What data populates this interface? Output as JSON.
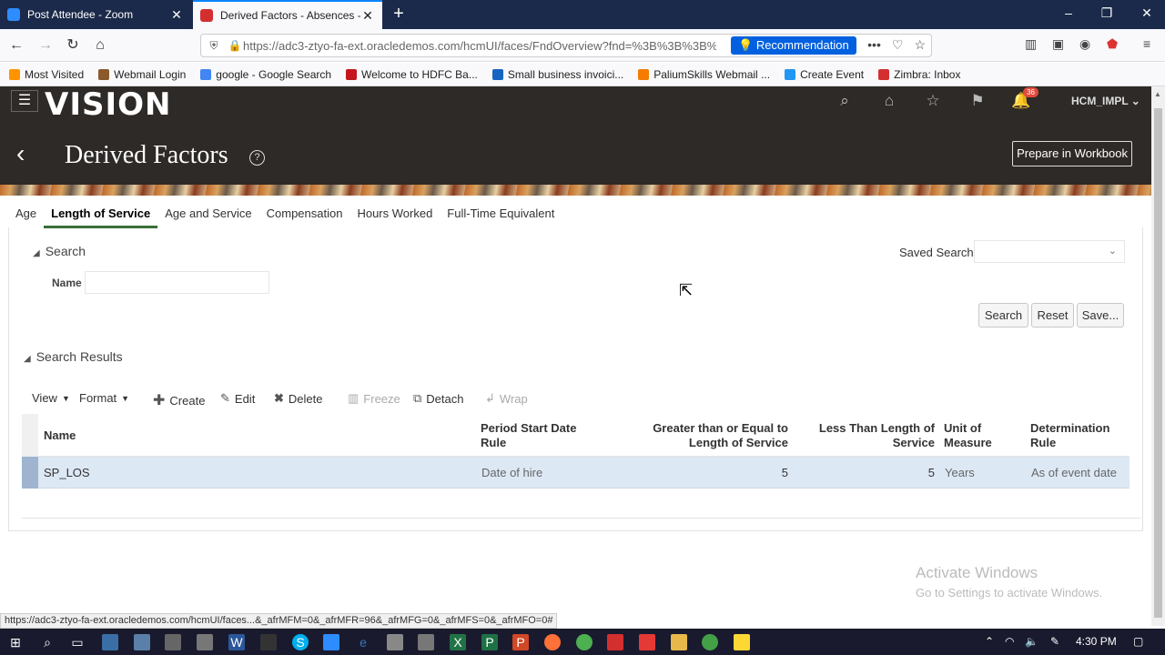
{
  "browser": {
    "tabs": [
      {
        "title": "Post Attendee - Zoom",
        "icon_color": "#2d8cff"
      },
      {
        "title": "Derived Factors - Absences - Or",
        "icon_color": "#d32f2f"
      }
    ],
    "url": "https://adc3-ztyo-fa-ext.oracledemos.com/hcmUI/faces/FndOverview?fnd=%3B%3B%3B%3",
    "recommendation_label": "Recommendation",
    "bookmarks": [
      {
        "label": "Most Visited",
        "color": "#ff9400"
      },
      {
        "label": "Webmail Login",
        "color": "#8b5a2b"
      },
      {
        "label": "google - Google Search",
        "color": "#4285f4"
      },
      {
        "label": "Welcome to HDFC Ba...",
        "color": "#c4161c"
      },
      {
        "label": "Small business invoici...",
        "color": "#1565c0"
      },
      {
        "label": "PaliumSkills Webmail ...",
        "color": "#f57c00"
      },
      {
        "label": "Create Event",
        "color": "#2196f3"
      },
      {
        "label": "Zimbra: Inbox",
        "color": "#d32f2f"
      }
    ]
  },
  "app": {
    "logo": "VISION",
    "user": "HCM_IMPL",
    "notifications": "36",
    "page_title": "Derived Factors",
    "prepare_btn": "Prepare in Workbook",
    "tabs": [
      "Age",
      "Length of Service",
      "Age and Service",
      "Compensation",
      "Hours Worked",
      "Full-Time Equivalent"
    ],
    "selected_tab": "Length of Service"
  },
  "search": {
    "header": "Search",
    "name_label": "Name",
    "name_value": "",
    "saved_search_label": "Saved Search",
    "saved_search_value": "",
    "buttons": {
      "search": "Search",
      "reset": "Reset",
      "save": "Save..."
    }
  },
  "results": {
    "header": "Search Results",
    "toolbar": {
      "view": "View",
      "format": "Format",
      "create": "Create",
      "edit": "Edit",
      "delete": "Delete",
      "freeze": "Freeze",
      "detach": "Detach",
      "wrap": "Wrap"
    },
    "columns": {
      "name": "Name",
      "period_start_1": "Period Start Date",
      "period_start_2": "Rule",
      "gte_1": "Greater than or Equal to",
      "gte_2": "Length of Service",
      "lt_1": "Less Than Length of",
      "lt_2": "Service",
      "uom_1": "Unit of",
      "uom_2": "Measure",
      "det_1": "Determination",
      "det_2": "Rule"
    },
    "rows": [
      {
        "name": "SP_LOS",
        "period_start": "Date of hire",
        "gte": "5",
        "lt": "5",
        "uom": "Years",
        "determination": "As of event date"
      }
    ]
  },
  "status_url": "https://adc3-ztyo-fa-ext.oracledemos.com/hcmUI/faces...&_afrMFM=0&_afrMFR=96&_afrMFG=0&_afrMFS=0&_afrMFO=0#",
  "watermark": {
    "line1": "Activate Windows",
    "line2": "Go to Settings to activate Windows."
  },
  "clock": "4:30 PM"
}
